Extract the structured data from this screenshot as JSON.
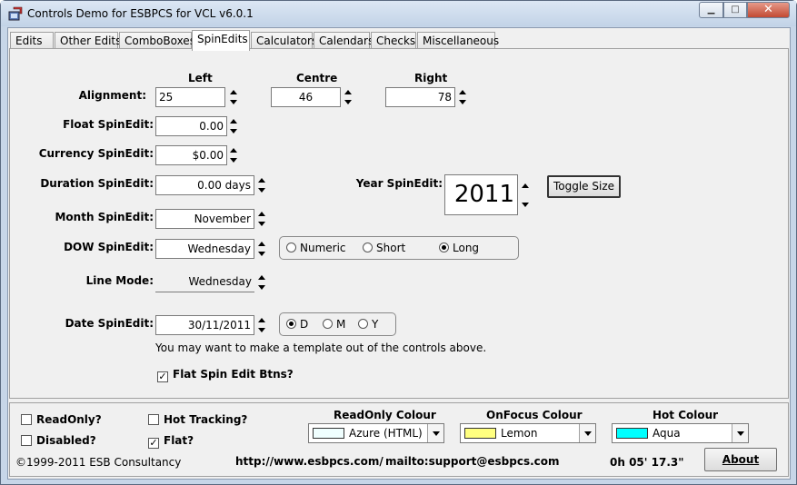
{
  "window": {
    "title": "Controls Demo for ESBPCS for VCL v6.0.1",
    "min_symbol": "▁",
    "max_symbol": "□",
    "close_symbol": "✕"
  },
  "tabs": [
    {
      "label": "Edits"
    },
    {
      "label": "Other Edits"
    },
    {
      "label": "ComboBoxes"
    },
    {
      "label": "SpinEdits"
    },
    {
      "label": "Calculators"
    },
    {
      "label": "Calendars"
    },
    {
      "label": "Checks"
    },
    {
      "label": "Miscellaneous"
    }
  ],
  "active_tab": "SpinEdits",
  "spin": {
    "col_left": "Left",
    "col_centre": "Centre",
    "col_right": "Right",
    "alignment_label": "Alignment:",
    "alignment_left_value": "25",
    "alignment_centre_value": "46",
    "alignment_right_value": "78",
    "float_label": "Float SpinEdit:",
    "float_value": "0.00",
    "currency_label": "Currency SpinEdit:",
    "currency_value": "$0.00",
    "duration_label": "Duration SpinEdit:",
    "duration_value": "0.00 days",
    "year_label": "Year SpinEdit:",
    "year_value": "2011",
    "toggle_size_label": "Toggle Size",
    "month_label": "Month SpinEdit:",
    "month_value": "November",
    "dow_label": "DOW SpinEdit:",
    "dow_value": "Wednesday",
    "dow_options": [
      "Numeric",
      "Short",
      "Long"
    ],
    "dow_selected": "Long",
    "linemode_label": "Line Mode:",
    "linemode_value": "Wednesday",
    "date_label": "Date SpinEdit:",
    "date_value": "30/11/2011",
    "date_options": [
      "D",
      "M",
      "Y"
    ],
    "date_selected": "D",
    "hint_text": "You may want to make a template out of the controls above.",
    "flat_btns_label": "Flat Spin Edit Btns?",
    "flat_btns_checked": true
  },
  "bottom": {
    "readonly_label": "ReadOnly?",
    "readonly_checked": false,
    "disabled_label": "Disabled?",
    "disabled_checked": false,
    "hot_tracking_label": "Hot Tracking?",
    "hot_tracking_checked": false,
    "flat_label": "Flat?",
    "flat_checked": true,
    "readonly_colour_label": "ReadOnly Colour",
    "readonly_colour_value": "Azure (HTML)",
    "readonly_colour_hex": "#f0ffff",
    "onfocus_colour_label": "OnFocus Colour",
    "onfocus_colour_value": "Lemon",
    "onfocus_colour_hex": "#ffff80",
    "hot_colour_label": "Hot Colour",
    "hot_colour_value": "Aqua",
    "hot_colour_hex": "#00ffff",
    "copyright": "©1999-2011 ESB Consultancy",
    "url": "http://www.esbpcs.com/",
    "mailto": "mailto:support@esbpcs.com",
    "timer": "0h 05' 17.3\"",
    "about_label": "About"
  }
}
